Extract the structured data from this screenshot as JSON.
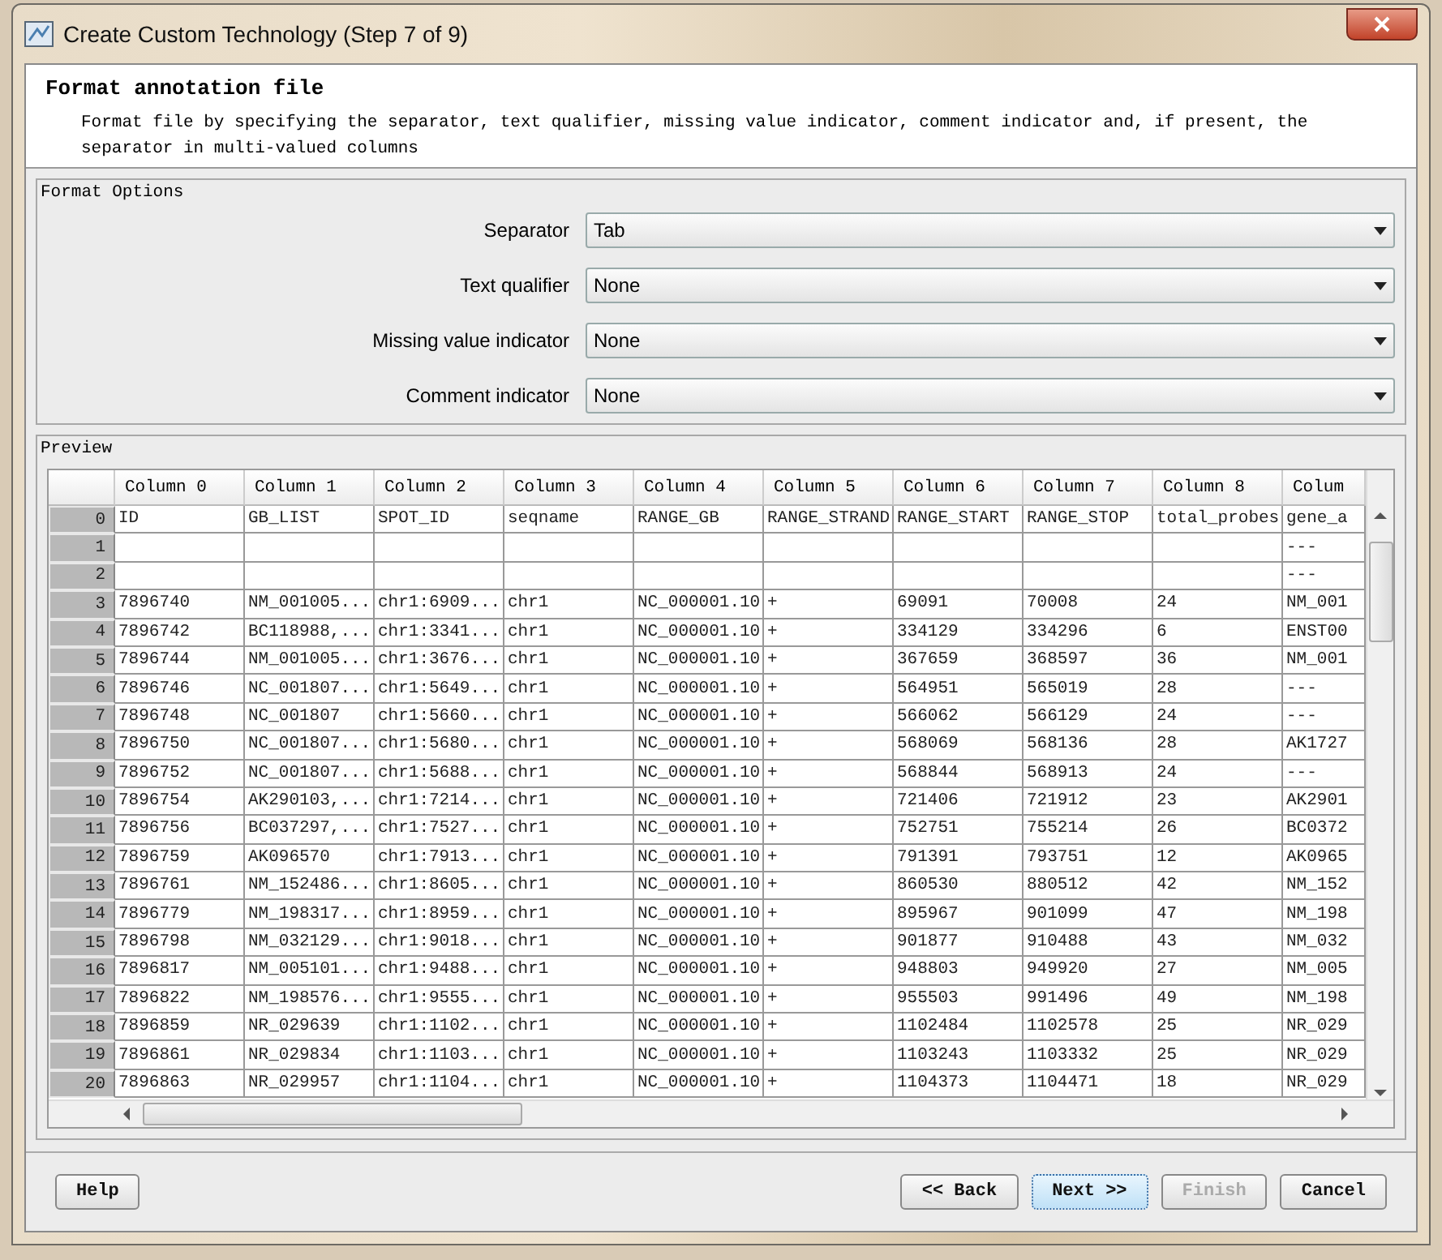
{
  "window": {
    "title": "Create Custom Technology (Step 7 of 9)"
  },
  "header": {
    "title": "Format annotation file",
    "description": "Format file by specifying the separator, text qualifier, missing value indicator, comment indicator and, if present, the separator in multi-valued columns"
  },
  "format_options": {
    "title": "Format Options",
    "fields": [
      {
        "label": "Separator",
        "value": "Tab"
      },
      {
        "label": "Text qualifier",
        "value": "None"
      },
      {
        "label": "Missing value indicator",
        "value": "None"
      },
      {
        "label": "Comment indicator",
        "value": "None"
      }
    ]
  },
  "preview": {
    "title": "Preview",
    "columns": [
      "Column 0",
      "Column 1",
      "Column 2",
      "Column 3",
      "Column 4",
      "Column 5",
      "Column 6",
      "Column 7",
      "Column 8",
      "Colum"
    ],
    "rows": [
      {
        "num": "0",
        "cells": [
          "ID",
          "GB_LIST",
          "SPOT_ID",
          "seqname",
          "RANGE_GB",
          "RANGE_STRAND",
          "RANGE_START",
          "RANGE_STOP",
          "total_probes",
          "gene_a"
        ]
      },
      {
        "num": "1",
        "cells": [
          null,
          null,
          null,
          null,
          null,
          null,
          null,
          null,
          null,
          "---"
        ]
      },
      {
        "num": "2",
        "cells": [
          null,
          null,
          null,
          null,
          null,
          null,
          null,
          null,
          null,
          "---"
        ]
      },
      {
        "num": "3",
        "cells": [
          "7896740",
          "NM_001005...",
          "chr1:6909...",
          "chr1",
          "NC_000001.10",
          "+",
          "69091",
          "70008",
          "24",
          "NM_001"
        ]
      },
      {
        "num": "4",
        "cells": [
          "7896742",
          "BC118988,...",
          "chr1:3341...",
          "chr1",
          "NC_000001.10",
          "+",
          "334129",
          "334296",
          "6",
          "ENST00"
        ]
      },
      {
        "num": "5",
        "cells": [
          "7896744",
          "NM_001005...",
          "chr1:3676...",
          "chr1",
          "NC_000001.10",
          "+",
          "367659",
          "368597",
          "36",
          "NM_001"
        ]
      },
      {
        "num": "6",
        "cells": [
          "7896746",
          "NC_001807...",
          "chr1:5649...",
          "chr1",
          "NC_000001.10",
          "+",
          "564951",
          "565019",
          "28",
          "---"
        ]
      },
      {
        "num": "7",
        "cells": [
          "7896748",
          "NC_001807",
          "chr1:5660...",
          "chr1",
          "NC_000001.10",
          "+",
          "566062",
          "566129",
          "24",
          "---"
        ]
      },
      {
        "num": "8",
        "cells": [
          "7896750",
          "NC_001807...",
          "chr1:5680...",
          "chr1",
          "NC_000001.10",
          "+",
          "568069",
          "568136",
          "28",
          "AK1727"
        ]
      },
      {
        "num": "9",
        "cells": [
          "7896752",
          "NC_001807...",
          "chr1:5688...",
          "chr1",
          "NC_000001.10",
          "+",
          "568844",
          "568913",
          "24",
          "---"
        ]
      },
      {
        "num": "10",
        "cells": [
          "7896754",
          "AK290103,...",
          "chr1:7214...",
          "chr1",
          "NC_000001.10",
          "+",
          "721406",
          "721912",
          "23",
          "AK2901"
        ]
      },
      {
        "num": "11",
        "cells": [
          "7896756",
          "BC037297,...",
          "chr1:7527...",
          "chr1",
          "NC_000001.10",
          "+",
          "752751",
          "755214",
          "26",
          "BC0372"
        ]
      },
      {
        "num": "12",
        "cells": [
          "7896759",
          "AK096570",
          "chr1:7913...",
          "chr1",
          "NC_000001.10",
          "+",
          "791391",
          "793751",
          "12",
          "AK0965"
        ]
      },
      {
        "num": "13",
        "cells": [
          "7896761",
          "NM_152486...",
          "chr1:8605...",
          "chr1",
          "NC_000001.10",
          "+",
          "860530",
          "880512",
          "42",
          "NM_152"
        ]
      },
      {
        "num": "14",
        "cells": [
          "7896779",
          "NM_198317...",
          "chr1:8959...",
          "chr1",
          "NC_000001.10",
          "+",
          "895967",
          "901099",
          "47",
          "NM_198"
        ]
      },
      {
        "num": "15",
        "cells": [
          "7896798",
          "NM_032129...",
          "chr1:9018...",
          "chr1",
          "NC_000001.10",
          "+",
          "901877",
          "910488",
          "43",
          "NM_032"
        ]
      },
      {
        "num": "16",
        "cells": [
          "7896817",
          "NM_005101...",
          "chr1:9488...",
          "chr1",
          "NC_000001.10",
          "+",
          "948803",
          "949920",
          "27",
          "NM_005"
        ]
      },
      {
        "num": "17",
        "cells": [
          "7896822",
          "NM_198576...",
          "chr1:9555...",
          "chr1",
          "NC_000001.10",
          "+",
          "955503",
          "991496",
          "49",
          "NM_198"
        ]
      },
      {
        "num": "18",
        "cells": [
          "7896859",
          "NR_029639",
          "chr1:1102...",
          "chr1",
          "NC_000001.10",
          "+",
          "1102484",
          "1102578",
          "25",
          "NR_029"
        ]
      },
      {
        "num": "19",
        "cells": [
          "7896861",
          "NR_029834",
          "chr1:1103...",
          "chr1",
          "NC_000001.10",
          "+",
          "1103243",
          "1103332",
          "25",
          "NR_029"
        ]
      },
      {
        "num": "20",
        "cells": [
          "7896863",
          "NR_029957",
          "chr1:1104...",
          "chr1",
          "NC_000001.10",
          "+",
          "1104373",
          "1104471",
          "18",
          "NR_029"
        ]
      }
    ]
  },
  "help_button": {
    "label": "Help"
  },
  "buttons": [
    {
      "label": "<< Back",
      "disabled": false,
      "focused": false
    },
    {
      "label": "Next >>",
      "disabled": false,
      "focused": true
    },
    {
      "label": "Finish",
      "disabled": true,
      "focused": false
    },
    {
      "label": "Cancel",
      "disabled": false,
      "focused": false
    }
  ]
}
